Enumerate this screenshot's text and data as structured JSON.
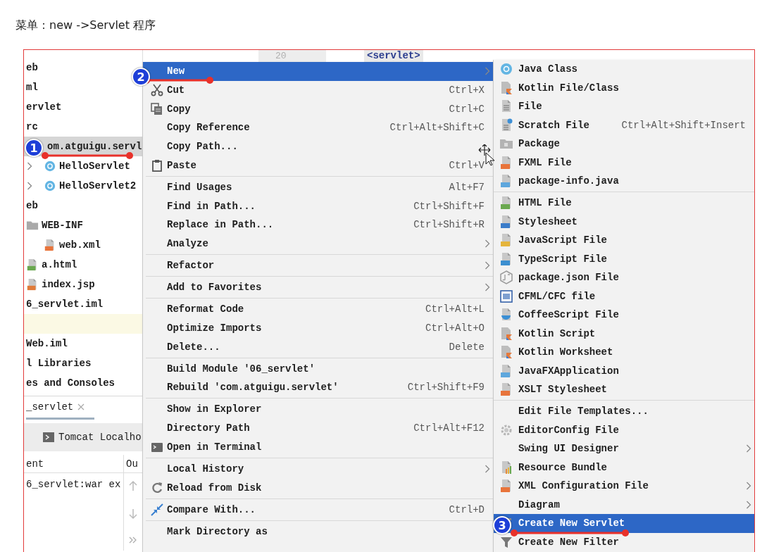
{
  "caption": "菜单：new ->Servlet 程序",
  "editor": {
    "line_number": "20",
    "code": "<servlet>"
  },
  "project_tree": {
    "items": [
      {
        "label": "eb",
        "selected": false
      },
      {
        "label": "ml",
        "selected": false
      },
      {
        "label": "ervlet",
        "selected": false
      },
      {
        "label": "rc",
        "selected": false,
        "children": [
          {
            "label": "om.atguigu.servl",
            "selected": true,
            "children": [
              {
                "label": "HelloServlet",
                "kind": "class",
                "expanded": false,
                "selected": false
              },
              {
                "label": "HelloServlet2",
                "kind": "class",
                "expanded": false,
                "selected": false
              }
            ]
          }
        ]
      },
      {
        "label": "eb",
        "selected": false,
        "children": [
          {
            "label": "WEB-INF",
            "kind": "folder",
            "selected": false,
            "children": [
              {
                "label": "web.xml",
                "kind": "xml",
                "selected": false
              }
            ]
          },
          {
            "label": "a.html",
            "kind": "html",
            "selected": false
          },
          {
            "label": "index.jsp",
            "kind": "jsp",
            "selected": false
          }
        ]
      },
      {
        "label": "6_servlet.iml",
        "selected": false
      },
      {
        "kind": "blank",
        "highlighted": true
      },
      {
        "label": "Web.iml",
        "selected": false
      },
      {
        "label": "l Libraries",
        "selected": false
      },
      {
        "label": "es and Consoles",
        "selected": false
      }
    ]
  },
  "run_panel": {
    "tab": {
      "label": "_servlet",
      "closable": true
    },
    "configuration": "Tomcat Localho",
    "columns": [
      "ent",
      "Ou"
    ],
    "rows": [
      [
        "6_servlet:war ex"
      ]
    ]
  },
  "context_menu": {
    "items": [
      {
        "kind": "plain",
        "label": "New",
        "submenu": true,
        "selected": true
      },
      {
        "kind": "cut",
        "label": "Cut",
        "shortcut": "Ctrl+X",
        "submenu": false,
        "selected": false
      },
      {
        "kind": "copy",
        "label": "Copy",
        "shortcut": "Ctrl+C",
        "submenu": false,
        "selected": false
      },
      {
        "kind": "plain",
        "label": "Copy Reference",
        "shortcut": "Ctrl+Alt+Shift+C",
        "submenu": false,
        "selected": false
      },
      {
        "kind": "plain",
        "label": "Copy Path...",
        "submenu": false,
        "selected": false
      },
      {
        "kind": "paste",
        "label": "Paste",
        "shortcut": "Ctrl+V",
        "submenu": false,
        "selected": false
      },
      {
        "kind": "separator"
      },
      {
        "kind": "plain",
        "label": "Find Usages",
        "shortcut": "Alt+F7",
        "submenu": false,
        "selected": false
      },
      {
        "kind": "plain",
        "label": "Find in Path...",
        "shortcut": "Ctrl+Shift+F",
        "submenu": false,
        "selected": false
      },
      {
        "kind": "plain",
        "label": "Replace in Path...",
        "shortcut": "Ctrl+Shift+R",
        "submenu": false,
        "selected": false
      },
      {
        "kind": "plain",
        "label": "Analyze",
        "submenu": true,
        "selected": false
      },
      {
        "kind": "separator"
      },
      {
        "kind": "plain",
        "label": "Refactor",
        "submenu": true,
        "selected": false
      },
      {
        "kind": "separator"
      },
      {
        "kind": "plain",
        "label": "Add to Favorites",
        "submenu": true,
        "selected": false
      },
      {
        "kind": "separator"
      },
      {
        "kind": "plain",
        "label": "Reformat Code",
        "shortcut": "Ctrl+Alt+L",
        "submenu": false,
        "selected": false
      },
      {
        "kind": "plain",
        "label": "Optimize Imports",
        "shortcut": "Ctrl+Alt+O",
        "submenu": false,
        "selected": false
      },
      {
        "kind": "plain",
        "label": "Delete...",
        "shortcut": "Delete",
        "submenu": false,
        "selected": false
      },
      {
        "kind": "separator"
      },
      {
        "kind": "plain",
        "label": "Build Module '06_servlet'",
        "submenu": false,
        "selected": false
      },
      {
        "kind": "plain",
        "label": "Rebuild 'com.atguigu.servlet'",
        "shortcut": "Ctrl+Shift+F9",
        "submenu": false,
        "selected": false
      },
      {
        "kind": "separator"
      },
      {
        "kind": "plain",
        "label": "Show in Explorer",
        "submenu": false,
        "selected": false
      },
      {
        "kind": "plain",
        "label": "Directory Path",
        "shortcut": "Ctrl+Alt+F12",
        "submenu": false,
        "selected": false
      },
      {
        "kind": "terminal",
        "label": "Open in Terminal",
        "submenu": false,
        "selected": false
      },
      {
        "kind": "separator"
      },
      {
        "kind": "plain",
        "label": "Local History",
        "submenu": true,
        "selected": false
      },
      {
        "kind": "reload",
        "label": "Reload from Disk",
        "submenu": false,
        "selected": false
      },
      {
        "kind": "separator"
      },
      {
        "kind": "compare",
        "label": "Compare With...",
        "shortcut": "Ctrl+D",
        "submenu": false,
        "selected": false
      },
      {
        "kind": "separator"
      },
      {
        "kind": "plain",
        "label": "Mark Directory as",
        "submenu": false,
        "selected": false
      }
    ]
  },
  "new_submenu": {
    "items": [
      {
        "kind": "java-class",
        "label": "Java Class",
        "submenu": false,
        "selected": false
      },
      {
        "kind": "kotlin",
        "label": "Kotlin File/Class",
        "submenu": false,
        "selected": false
      },
      {
        "kind": "file",
        "label": "File",
        "submenu": false,
        "selected": false
      },
      {
        "kind": "scratch",
        "label": "Scratch File",
        "shortcut": "Ctrl+Alt+Shift+Insert",
        "submenu": false,
        "selected": false
      },
      {
        "kind": "package",
        "label": "Package",
        "submenu": false,
        "selected": false
      },
      {
        "kind": "fxml",
        "label": "FXML File",
        "submenu": false,
        "selected": false
      },
      {
        "kind": "package-info",
        "label": "package-info.java",
        "submenu": false,
        "selected": false
      },
      {
        "kind": "separator"
      },
      {
        "kind": "html",
        "label": "HTML File",
        "submenu": false,
        "selected": false
      },
      {
        "kind": "stylesheet",
        "label": "Stylesheet",
        "submenu": false,
        "selected": false
      },
      {
        "kind": "javascript",
        "label": "JavaScript File",
        "submenu": false,
        "selected": false
      },
      {
        "kind": "typescript",
        "label": "TypeScript File",
        "submenu": false,
        "selected": false
      },
      {
        "kind": "package-json",
        "label": "package.json File",
        "submenu": false,
        "selected": false
      },
      {
        "kind": "cfml",
        "label": "CFML/CFC file",
        "submenu": false,
        "selected": false
      },
      {
        "kind": "coffeescript",
        "label": "CoffeeScript File",
        "submenu": false,
        "selected": false
      },
      {
        "kind": "kotlin",
        "label": "Kotlin Script",
        "submenu": false,
        "selected": false
      },
      {
        "kind": "kotlin",
        "label": "Kotlin Worksheet",
        "submenu": false,
        "selected": false
      },
      {
        "kind": "javafx",
        "label": "JavaFXApplication",
        "submenu": false,
        "selected": false
      },
      {
        "kind": "xslt",
        "label": "XSLT Stylesheet",
        "submenu": false,
        "selected": false
      },
      {
        "kind": "separator"
      },
      {
        "kind": "plain",
        "label": "Edit File Templates...",
        "submenu": false,
        "selected": false
      },
      {
        "kind": "editorconfig",
        "label": "EditorConfig File",
        "submenu": false,
        "selected": false
      },
      {
        "kind": "plain",
        "label": "Swing UI Designer",
        "submenu": true,
        "selected": false
      },
      {
        "kind": "resource-bundle",
        "label": "Resource Bundle",
        "submenu": false,
        "selected": false
      },
      {
        "kind": "xml-config",
        "label": "XML Configuration File",
        "submenu": true,
        "selected": false
      },
      {
        "kind": "plain",
        "label": "Diagram",
        "submenu": true,
        "selected": false
      },
      {
        "kind": "servlet",
        "label": "Create New Servlet",
        "submenu": false,
        "selected": true
      },
      {
        "kind": "filter",
        "label": "Create New Filter",
        "submenu": false,
        "selected": false
      }
    ]
  },
  "callouts": [
    {
      "number": "1"
    },
    {
      "number": "2"
    },
    {
      "number": "3"
    }
  ]
}
